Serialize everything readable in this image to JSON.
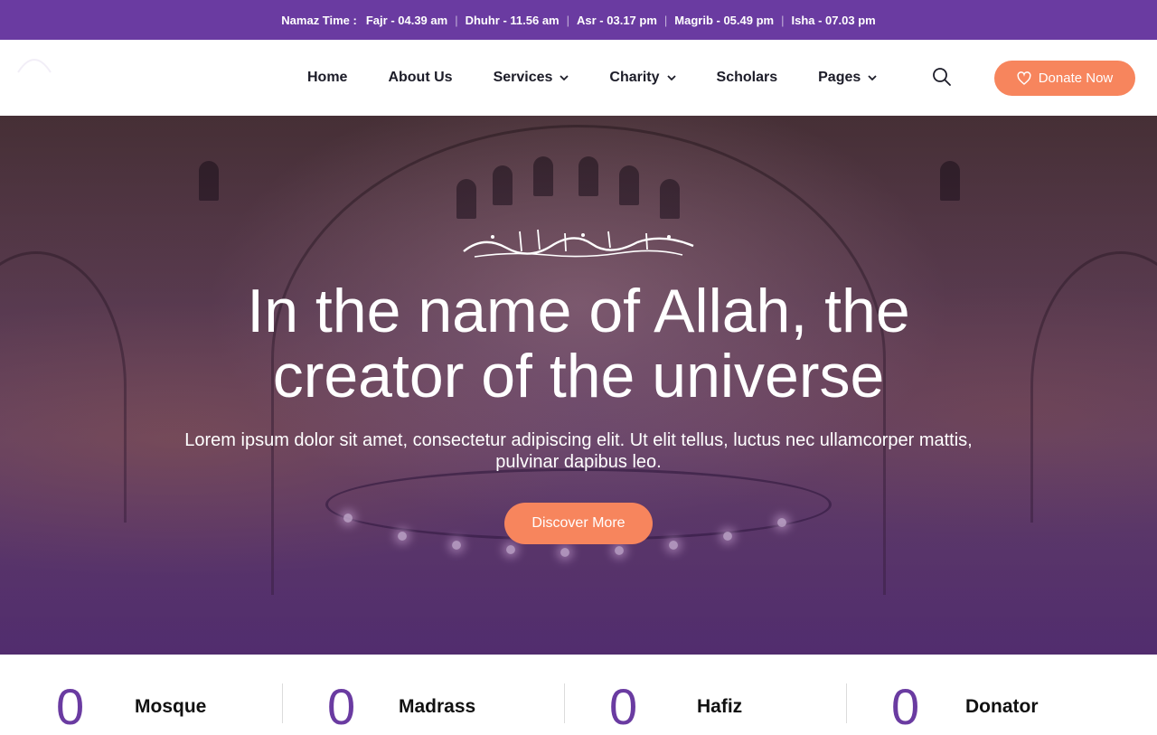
{
  "topbar": {
    "label": "Namaz Time :",
    "times": [
      "Fajr - 04.39 am",
      "Dhuhr - 11.56 am",
      "Asr - 03.17 pm",
      "Magrib - 05.49 pm",
      "Isha - 07.03 pm"
    ],
    "bg_color": "#6a3ba1"
  },
  "nav": {
    "items": [
      {
        "label": "Home",
        "has_dropdown": false
      },
      {
        "label": "About Us",
        "has_dropdown": false
      },
      {
        "label": "Services",
        "has_dropdown": true
      },
      {
        "label": "Charity",
        "has_dropdown": true
      },
      {
        "label": "Scholars",
        "has_dropdown": false
      },
      {
        "label": "Pages",
        "has_dropdown": true
      }
    ],
    "search_icon": "search-icon",
    "donate_label": "Donate Now",
    "donate_icon": "heart-icon",
    "accent_color": "#f7855d"
  },
  "hero": {
    "calligraphy": "بسم الله الرحمن الرحيم",
    "title_line1": "In the name of Allah, the",
    "title_line2": "creator of the universe",
    "subtitle_line1": "Lorem ipsum dolor sit amet, consectetur adipiscing elit. Ut elit tellus, luctus nec ullamcorper mattis,",
    "subtitle_line2": "pulvinar dapibus leo.",
    "cta_label": "Discover More"
  },
  "stats": [
    {
      "value": "0",
      "label": "Mosque"
    },
    {
      "value": "0",
      "label": "Madrass"
    },
    {
      "value": "0",
      "label": "Hafiz"
    },
    {
      "value": "0",
      "label": "Donator"
    }
  ]
}
